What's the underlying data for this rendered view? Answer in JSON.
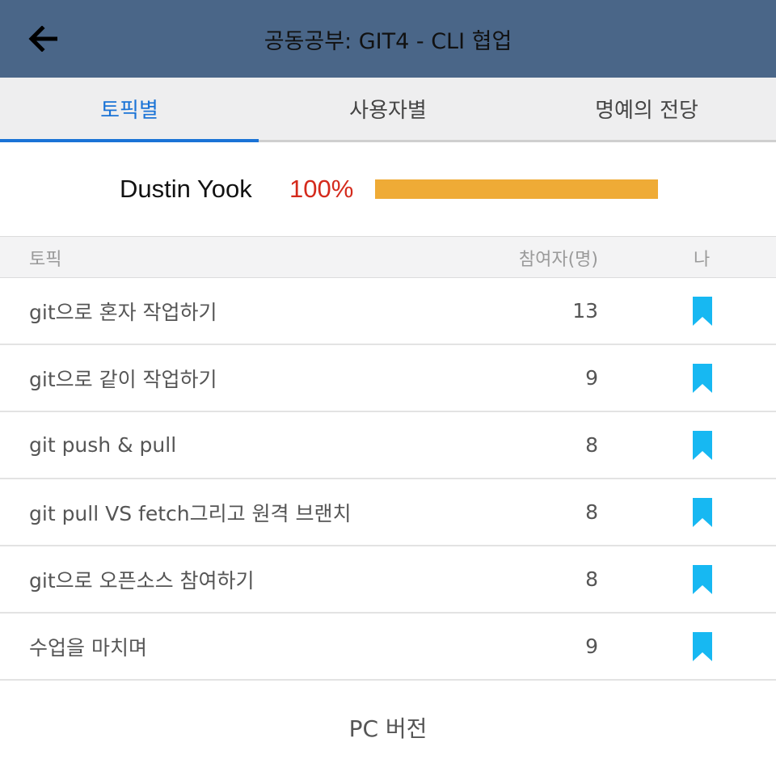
{
  "header": {
    "title": "공동공부: GIT4 - CLI 협업",
    "background": "#4a6688"
  },
  "tabs": [
    {
      "label": "토픽별",
      "active": true
    },
    {
      "label": "사용자별",
      "active": false
    },
    {
      "label": "명예의 전당",
      "active": false
    }
  ],
  "progress": {
    "user_name": "Dustin Yook",
    "percent_label": "100%",
    "fraction": 1.0,
    "bar_color": "#efab36"
  },
  "table": {
    "headers": {
      "topic": "토픽",
      "count": "참여자(명)",
      "me": "나"
    },
    "rows": [
      {
        "topic": "git으로 혼자 작업하기",
        "count": "13",
        "me_icon": "bookmark-icon"
      },
      {
        "topic": "git으로 같이 작업하기",
        "count": "9",
        "me_icon": "bookmark-icon"
      },
      {
        "topic": "git push & pull",
        "count": "8",
        "me_icon": "bookmark-icon"
      },
      {
        "topic": "git pull VS fetch그리고 원격 브랜치",
        "count": "8",
        "me_icon": "bookmark-icon"
      },
      {
        "topic": "git으로 오픈소스 참여하기",
        "count": "8",
        "me_icon": "bookmark-icon"
      },
      {
        "topic": "수업을 마치며",
        "count": "9",
        "me_icon": "bookmark-icon"
      }
    ]
  },
  "footer": {
    "pc_version_label": "PC 버전"
  },
  "colors": {
    "accent": "#1a73d6",
    "bookmark": "#17b8f2",
    "percent": "#d42a1c"
  }
}
